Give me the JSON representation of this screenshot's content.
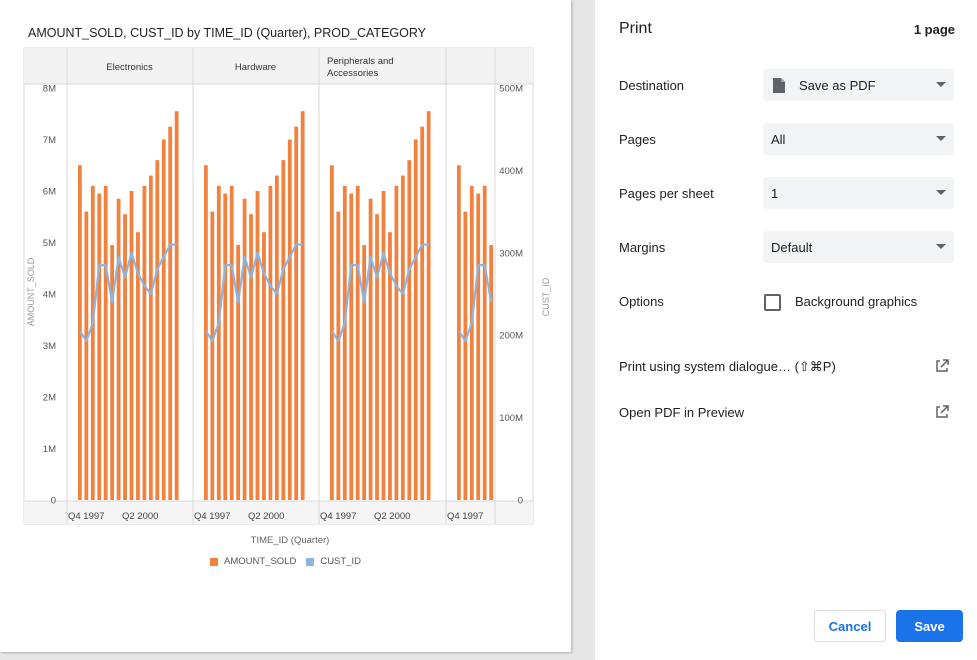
{
  "chart_data": {
    "type": "bar",
    "title": "AMOUNT_SOLD, CUST_ID by TIME_ID (Quarter), PROD_CATEGORY",
    "xlabel": "TIME_ID (Quarter)",
    "ylabel": "AMOUNT_SOLD",
    "y2label": "CUST_ID",
    "ylim": [
      0,
      8000000
    ],
    "y2lim": [
      0,
      500000000
    ],
    "yticks": [
      "0",
      "1M",
      "2M",
      "3M",
      "4M",
      "5M",
      "6M",
      "7M",
      "8M"
    ],
    "y2ticks": [
      "0",
      "100M",
      "200M",
      "300M",
      "400M",
      "500M"
    ],
    "xtick_labels": [
      "Q4 1997",
      "Q2 2000"
    ],
    "panels": [
      "Electronics",
      "Hardware",
      "Peripherals and Accessories",
      ""
    ],
    "series": [
      {
        "name": "AMOUNT_SOLD",
        "type": "bar",
        "color": "#f0813f",
        "values": [
          6.5,
          5.6,
          6.1,
          5.95,
          6.1,
          4.95,
          5.85,
          5.55,
          6.0,
          5.2,
          6.1,
          6.3,
          6.6,
          7.0,
          7.25,
          7.55
        ]
      },
      {
        "name": "CUST_ID",
        "type": "line",
        "color": "#8fb4de",
        "values": [
          205,
          193,
          215,
          285,
          285,
          240,
          295,
          270,
          300,
          275,
          260,
          250,
          280,
          295,
          310,
          310
        ]
      }
    ]
  },
  "legend": {
    "items": [
      {
        "label": "AMOUNT_SOLD",
        "color": "#f0813f"
      },
      {
        "label": "CUST_ID",
        "color": "#8fb4de"
      }
    ]
  },
  "panel": {
    "title": "Print",
    "page_count": "1 page",
    "destination_label": "Destination",
    "destination_value": "Save as PDF",
    "pages_label": "Pages",
    "pages_value": "All",
    "pps_label": "Pages per sheet",
    "pps_value": "1",
    "margins_label": "Margins",
    "margins_value": "Default",
    "options_label": "Options",
    "bg_graphics_label": "Background graphics",
    "system_dialog_label": "Print using system dialogue… (⇧⌘P)",
    "open_preview_label": "Open PDF in Preview",
    "cancel_label": "Cancel",
    "save_label": "Save"
  }
}
